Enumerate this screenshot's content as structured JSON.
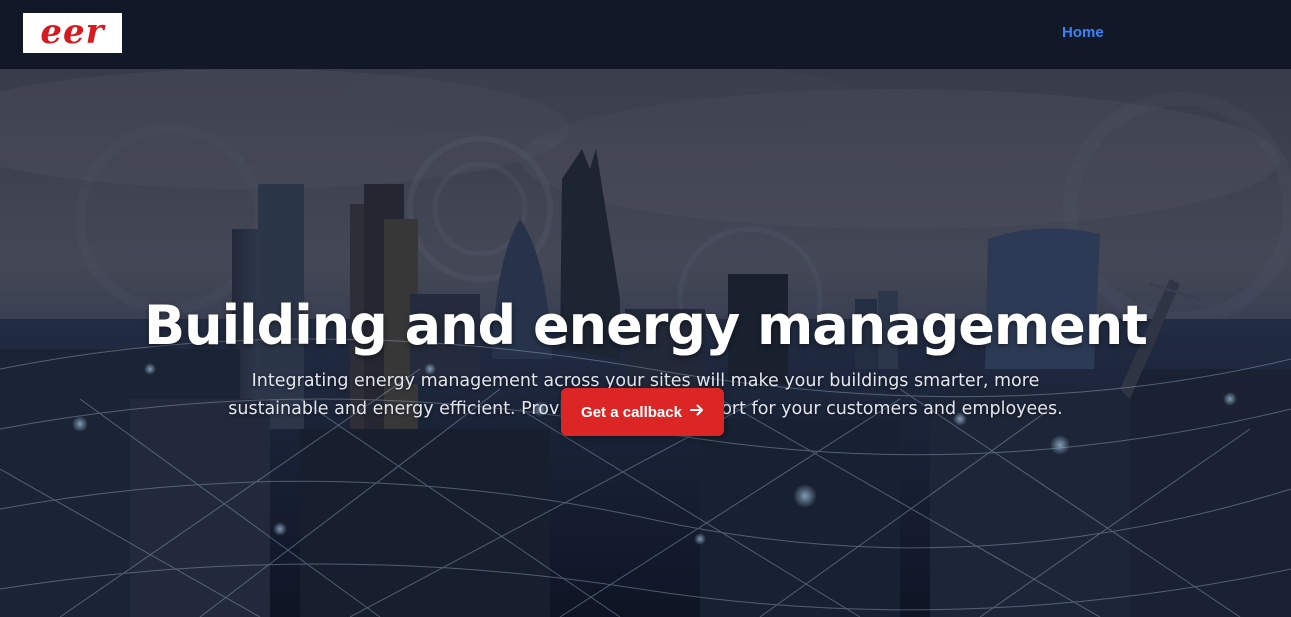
{
  "header": {
    "logo_text": "eer",
    "nav": [
      {
        "label": "Home"
      }
    ]
  },
  "hero": {
    "title": "Building and energy management",
    "subtitle": "Integrating energy management across your sites will make your buildings smarter, more sustainable and energy efficient. Providing greater comfort for your customers and employees.",
    "cta_label": "Get a callback",
    "cta_icon": "arrow-right-icon"
  },
  "colors": {
    "header_bg": "#111827",
    "nav_link": "#3b82f6",
    "cta_bg": "#dc2626",
    "logo_red": "#d71920"
  }
}
